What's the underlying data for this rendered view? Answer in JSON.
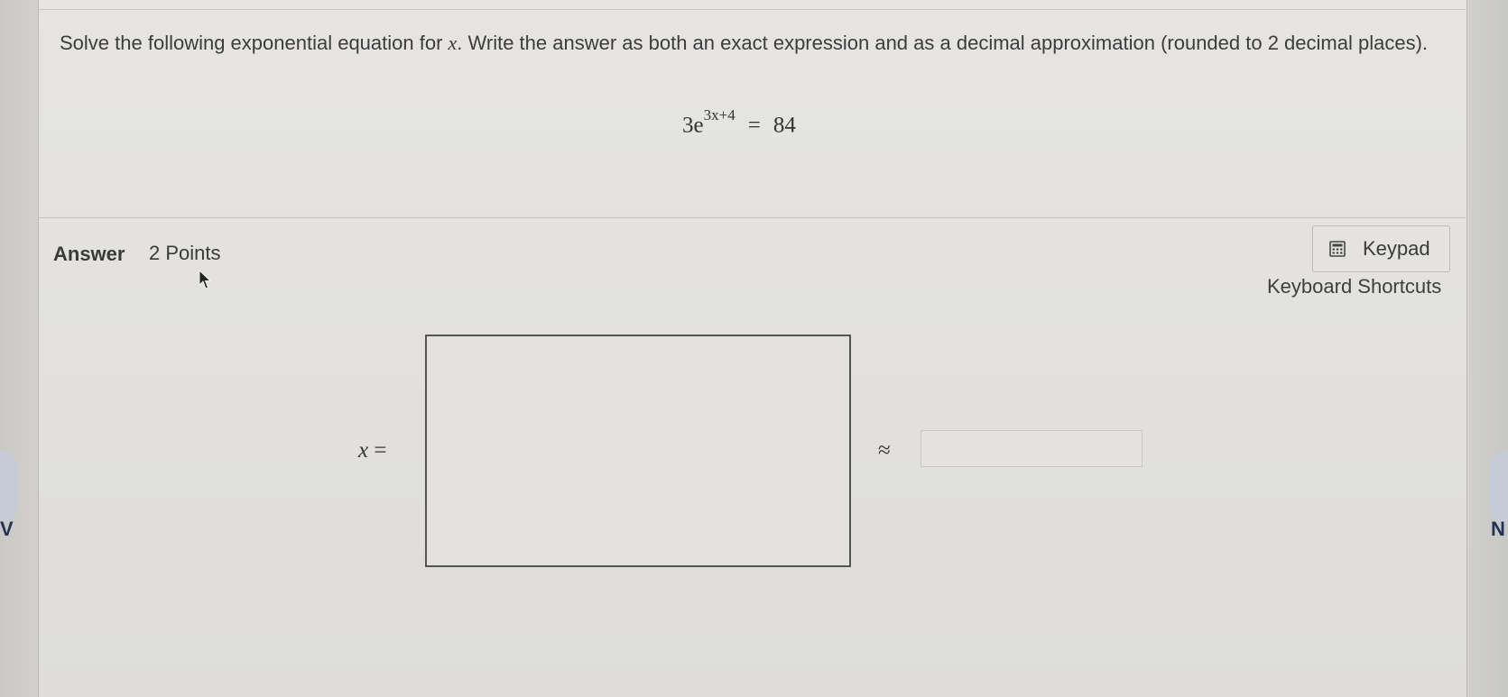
{
  "question": {
    "text": "Solve the following exponential equation for x. Write the answer as both an exact expression and as a decimal approximation (rounded to 2 decimal places).",
    "text_prefix": "Solve the following exponential equation for ",
    "variable": "x",
    "text_suffix": ". Write the answer as both an exact expression and as a decimal approximation (rounded to 2 decimal places).",
    "equation": {
      "coefficient": "3e",
      "exponent": "3x+4",
      "equals": "=",
      "rhs": "84"
    }
  },
  "answer": {
    "label": "Answer",
    "points": "2 Points",
    "x_variable": "x",
    "x_equals": "=",
    "approx_symbol": "≈",
    "exact_value": "",
    "decimal_value": ""
  },
  "toolbar": {
    "keypad_label": "Keypad",
    "keypad_icon": "calculator-icon",
    "shortcuts_label": "Keyboard Shortcuts"
  },
  "edge_nav": {
    "left_letter": "V",
    "right_letter": "N"
  },
  "colors": {
    "card_background": "#e4e3e0",
    "text": "#3a3a3a",
    "input_border": "#555555"
  }
}
